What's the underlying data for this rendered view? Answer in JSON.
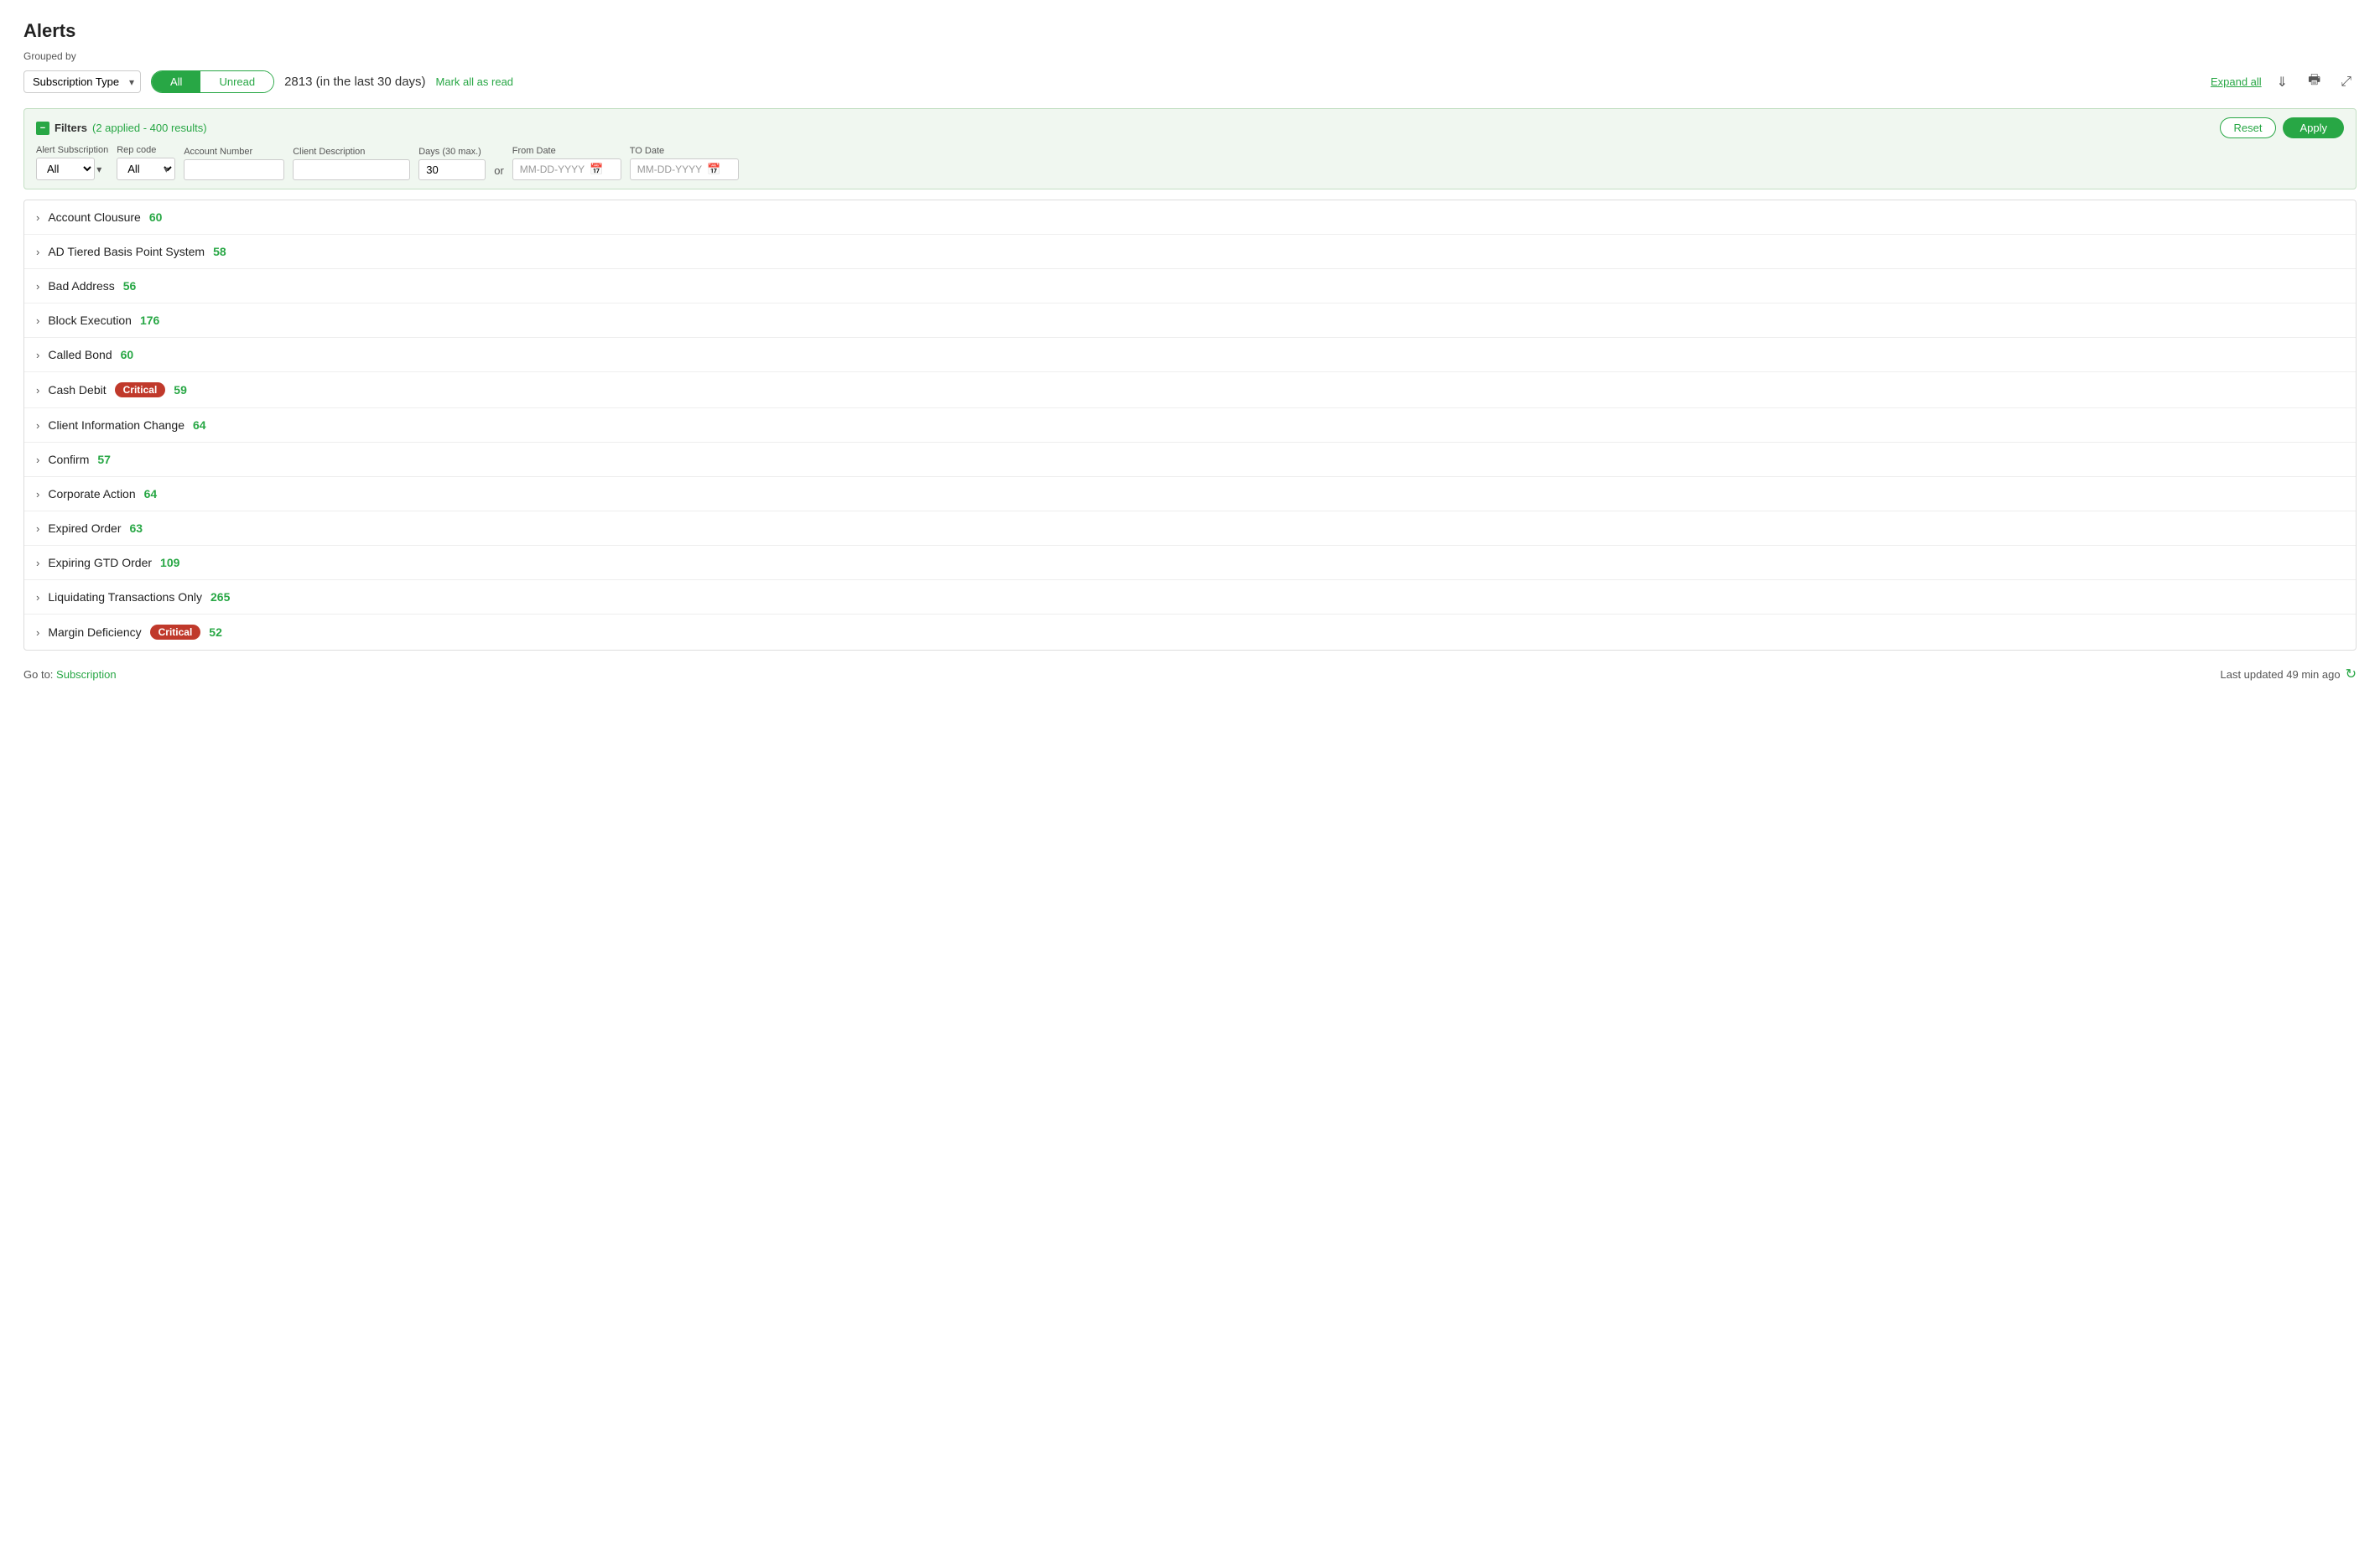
{
  "page": {
    "title": "Alerts",
    "grouped_by_label": "Grouped by",
    "subscription_type_label": "Subscription Type",
    "toggle": {
      "all_label": "All",
      "unread_label": "Unread"
    },
    "count": "2813",
    "count_suffix": " (in the last 30 days)",
    "mark_all_read": "Mark all as read",
    "expand_all": "Expand all",
    "filters": {
      "label": "Filters",
      "applied_text": "(2 applied - 400 results)",
      "reset_label": "Reset",
      "apply_label": "Apply",
      "fields": {
        "alert_subscription_label": "Alert Subscription",
        "alert_subscription_value": "All",
        "rep_code_label": "Rep code",
        "rep_code_value": "All",
        "account_number_label": "Account Number",
        "account_number_placeholder": "",
        "client_description_label": "Client Description",
        "client_description_placeholder": "",
        "days_label": "Days (30 max.)",
        "days_value": "30",
        "from_date_label": "From Date",
        "from_date_placeholder": "MM-DD-YYYY",
        "or_label": "or",
        "to_date_label": "TO Date",
        "to_date_placeholder": "MM-DD-YYYY"
      }
    },
    "alert_rows": [
      {
        "name": "Account Clousure",
        "count": "60",
        "critical": false
      },
      {
        "name": "AD Tiered Basis Point System",
        "count": "58",
        "critical": false
      },
      {
        "name": "Bad Address",
        "count": "56",
        "critical": false
      },
      {
        "name": "Block Execution",
        "count": "176",
        "critical": false
      },
      {
        "name": "Called Bond",
        "count": "60",
        "critical": false
      },
      {
        "name": "Cash Debit",
        "count": "59",
        "critical": true
      },
      {
        "name": "Client Information Change",
        "count": "64",
        "critical": false
      },
      {
        "name": "Confirm",
        "count": "57",
        "critical": false
      },
      {
        "name": "Corporate Action",
        "count": "64",
        "critical": false
      },
      {
        "name": "Expired Order",
        "count": "63",
        "critical": false
      },
      {
        "name": "Expiring GTD Order",
        "count": "109",
        "critical": false
      },
      {
        "name": "Liquidating Transactions Only",
        "count": "265",
        "critical": false
      },
      {
        "name": "Margin Deficiency",
        "count": "52",
        "critical": true
      }
    ],
    "footer": {
      "go_to_label": "Go to:",
      "subscription_link": "Subscription",
      "last_updated": "Last updated 49 min ago"
    },
    "critical_badge_label": "Critical",
    "download_icon_label": "⬇",
    "print_icon_label": "🖨",
    "external_icon_label": "⤢"
  }
}
